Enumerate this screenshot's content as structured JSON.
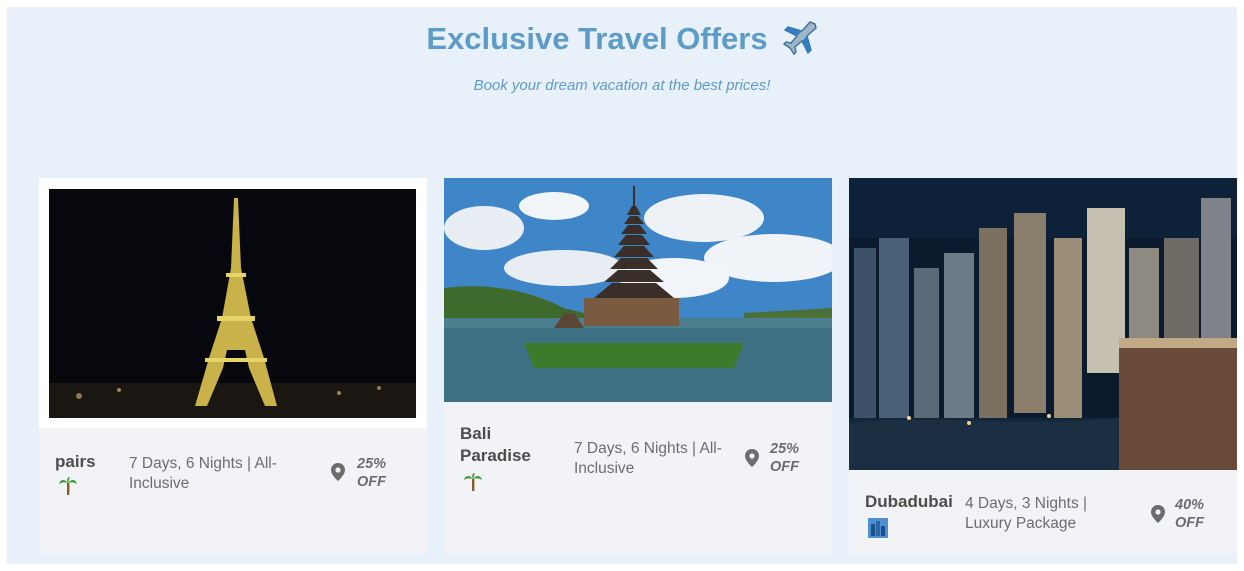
{
  "header": {
    "title": "Exclusive Travel Offers",
    "subtitle": "Book your dream vacation at the best prices!"
  },
  "offers": [
    {
      "name": "pairs",
      "description": "7 Days, 6 Nights | All-Inclusive",
      "discount": "25% OFF",
      "icon": "palm-tree-icon"
    },
    {
      "name": "Bali Paradise",
      "description": "7 Days, 6 Nights | All-Inclusive",
      "discount": "25% OFF",
      "icon": "palm-tree-icon"
    },
    {
      "name": "Dubadubai",
      "description": "4 Days, 3 Nights | Luxury Package",
      "discount": "40% OFF",
      "icon": "city-icon"
    }
  ],
  "colors": {
    "accent": "#5d9cc6",
    "panel": "#e8f0fa",
    "card": "#f1f3f6"
  }
}
